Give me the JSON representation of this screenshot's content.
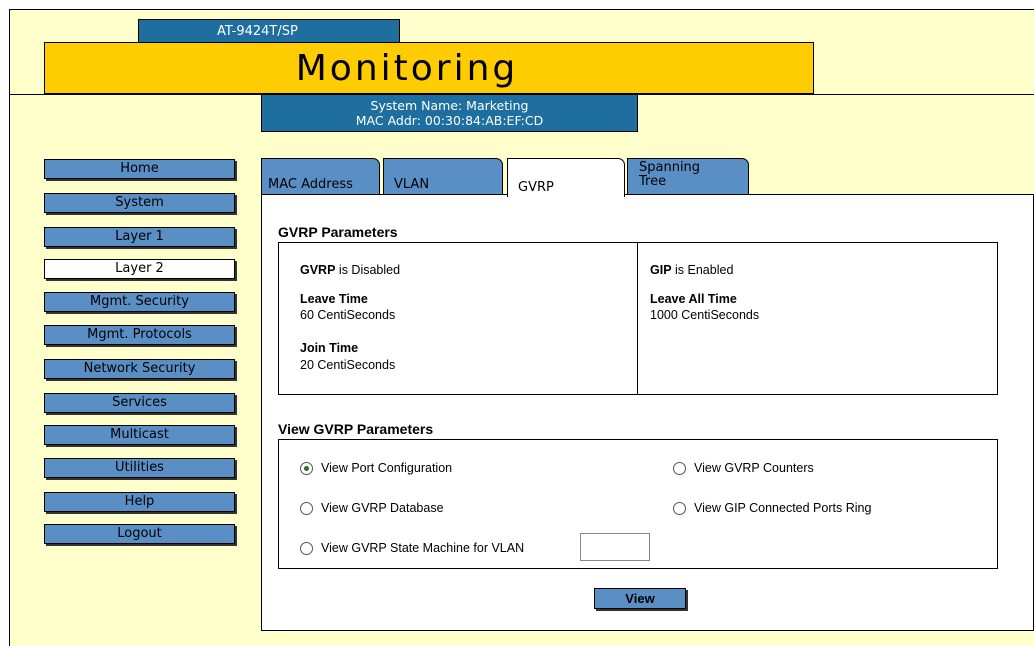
{
  "header": {
    "model": "AT-9424T/SP",
    "title": "Monitoring",
    "system_name": "System Name: Marketing",
    "mac_addr": "MAC Addr: 00:30:84:AB:EF:CD"
  },
  "nav": {
    "items": [
      {
        "label": "Home"
      },
      {
        "label": "System"
      },
      {
        "label": "Layer 1"
      },
      {
        "label": "Layer 2",
        "active": true
      },
      {
        "label": "Mgmt. Security"
      },
      {
        "label": "Mgmt. Protocols"
      },
      {
        "label": "Network Security"
      },
      {
        "label": "Services"
      },
      {
        "label": "Multicast"
      },
      {
        "label": "Utilities"
      },
      {
        "label": "Help"
      },
      {
        "label": "Logout"
      }
    ]
  },
  "tabs": [
    {
      "label": "MAC Address"
    },
    {
      "label": "VLAN"
    },
    {
      "label": "GVRP",
      "active": true
    },
    {
      "label": "Spanning",
      "label2": "Tree"
    }
  ],
  "gvrp_params": {
    "heading": "GVRP Parameters",
    "gvrp_label": "GVRP",
    "gvrp_status": " is Disabled",
    "leave_time_label": "Leave Time",
    "leave_time_value": "60 CentiSeconds",
    "join_time_label": "Join Time",
    "join_time_value": "20 CentiSeconds",
    "gip_label": "GIP",
    "gip_status": " is Enabled",
    "leave_all_label": "Leave All Time",
    "leave_all_value": "1000 CentiSeconds"
  },
  "view_params": {
    "heading": "View GVRP Parameters",
    "options": {
      "port_config": "View Port Configuration",
      "counters": "View GVRP Counters",
      "database": "View GVRP Database",
      "gip_ring": "View GIP Connected Ports Ring",
      "state_machine": "View GVRP State Machine for VLAN"
    },
    "selected": "port_config",
    "vlan_value": "",
    "view_button": "View"
  }
}
